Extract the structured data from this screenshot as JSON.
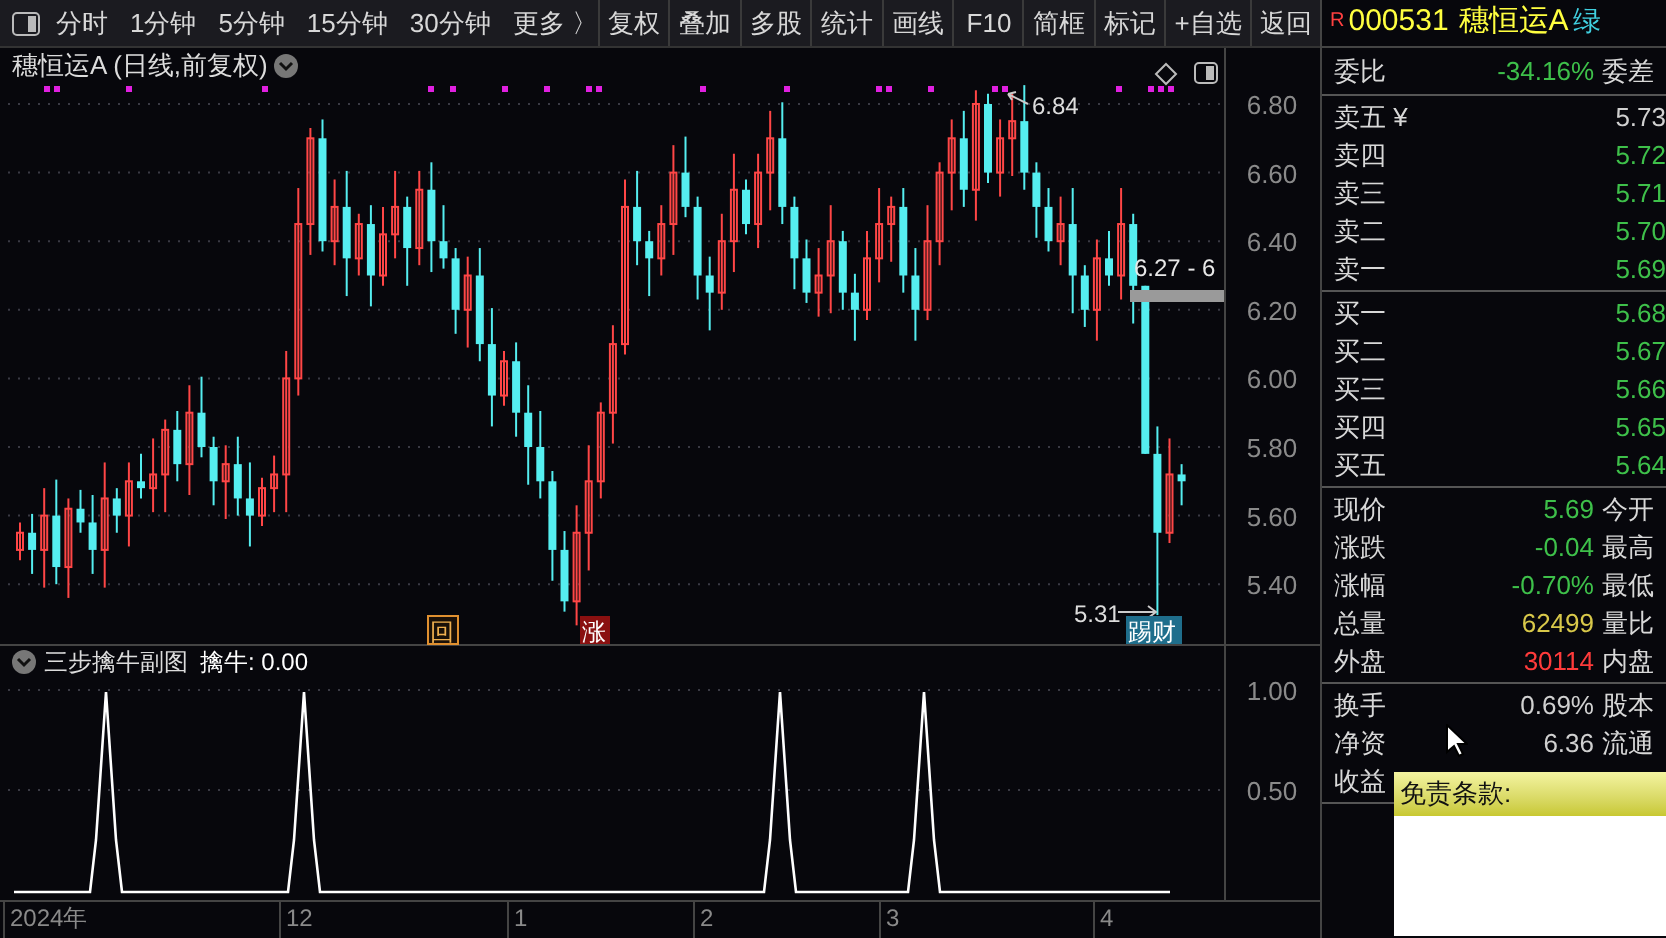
{
  "toolbar": {
    "periods": [
      "分时",
      "1分钟",
      "5分钟",
      "15分钟",
      "30分钟",
      "更多 〉"
    ],
    "buttons": [
      "复权",
      "叠加",
      "多股",
      "统计",
      "画线",
      "F10",
      "简框",
      "标记",
      "+自选",
      "返回"
    ]
  },
  "chart": {
    "title": "穗恒运A (日线,前复权)",
    "y_ticks": [
      "6.80",
      "6.60",
      "6.40",
      "6.20",
      "6.00",
      "5.80",
      "5.60",
      "5.40"
    ],
    "high_label": "6.84",
    "low_label": "5.31",
    "range_label": "6.27 - 6",
    "markers": [
      {
        "text": "回",
        "kind": "hollow"
      },
      {
        "text": "涨",
        "kind": "rise"
      },
      {
        "text": "踢财",
        "kind": "tag"
      }
    ]
  },
  "indicator": {
    "title": "三步擒牛副图",
    "reading": "擒牛: 0.00",
    "y_ticks": [
      "1.00",
      "0.50"
    ]
  },
  "x_labels": [
    "2024年",
    "12",
    "1",
    "2",
    "3",
    "4"
  ],
  "quote": {
    "flag": "R",
    "code": "000531",
    "name": "穗恒运A",
    "tag": "绿",
    "ratio": {
      "label": "委比",
      "value": "-34.16%",
      "color": "#3ec04a",
      "label2": "委差"
    },
    "asks": [
      {
        "label": "卖五 ¥",
        "price": "5.73",
        "color": "#d0d0d0"
      },
      {
        "label": "卖四",
        "price": "5.72",
        "color": "#3ec04a"
      },
      {
        "label": "卖三",
        "price": "5.71",
        "color": "#3ec04a"
      },
      {
        "label": "卖二",
        "price": "5.70",
        "color": "#3ec04a"
      },
      {
        "label": "卖一",
        "price": "5.69",
        "color": "#3ec04a"
      }
    ],
    "bids": [
      {
        "label": "买一",
        "price": "5.68",
        "color": "#3ec04a"
      },
      {
        "label": "买二",
        "price": "5.67",
        "color": "#3ec04a"
      },
      {
        "label": "买三",
        "price": "5.66",
        "color": "#3ec04a"
      },
      {
        "label": "买四",
        "price": "5.65",
        "color": "#3ec04a"
      },
      {
        "label": "买五",
        "price": "5.64",
        "color": "#3ec04a"
      }
    ],
    "stats": [
      {
        "label": "现价",
        "value": "5.69",
        "color": "#3ec04a",
        "label2": "今开"
      },
      {
        "label": "涨跌",
        "value": "-0.04",
        "color": "#3ec04a",
        "label2": "最高"
      },
      {
        "label": "涨幅",
        "value": "-0.70%",
        "color": "#3ec04a",
        "label2": "最低"
      },
      {
        "label": "总量",
        "value": "62499",
        "color": "#d8c84a",
        "label2": "量比"
      },
      {
        "label": "外盘",
        "value": "30114",
        "color": "#ff3b3b",
        "label2": "内盘"
      }
    ],
    "stats2": [
      {
        "label": "换手",
        "value": "0.69%",
        "color": "#d0d0d0",
        "label2": "股本"
      },
      {
        "label": "净资",
        "value": "6.36",
        "color": "#d0d0d0",
        "label2": "流通"
      },
      {
        "label": "收益"
      }
    ]
  },
  "tooltip": {
    "title": "免责条款:"
  }
}
